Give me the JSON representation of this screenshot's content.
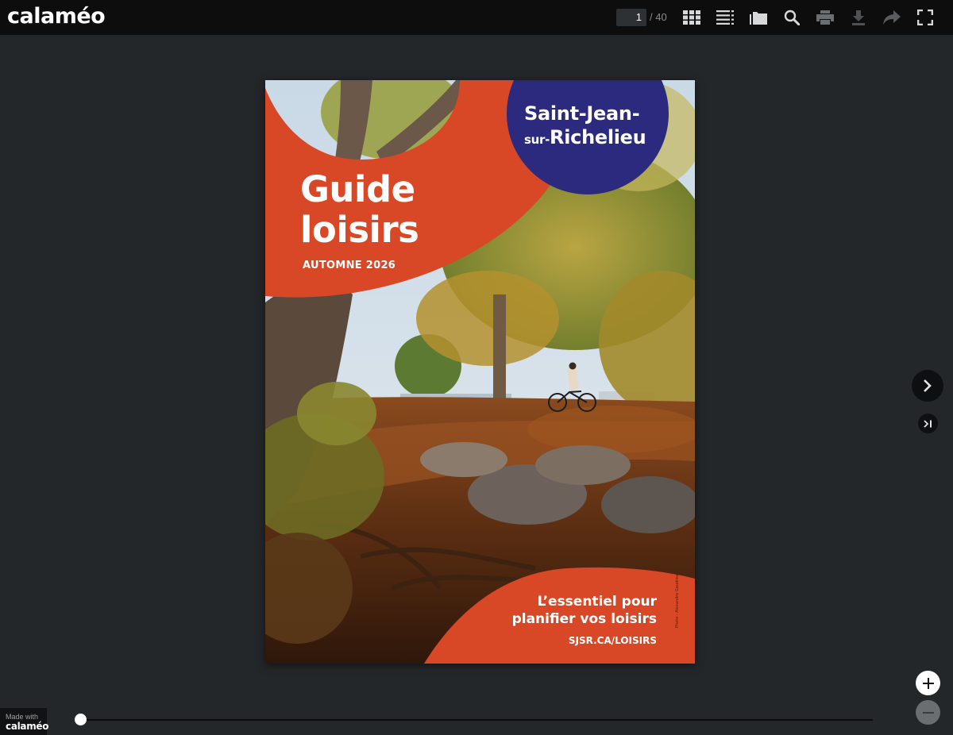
{
  "toolbar": {
    "logo": "calaméo",
    "current_page": "1",
    "total_pages": "/ 40",
    "icons": [
      "thumbnails-grid-icon",
      "table-of-contents-icon",
      "folder-icon",
      "search-icon",
      "print-icon",
      "download-icon",
      "share-icon",
      "fullscreen-icon"
    ]
  },
  "document": {
    "city_line1": "Saint-Jean-",
    "city_prefix": "sur-",
    "city_line2": "Richelieu",
    "title_line1": "Guide",
    "title_line2": "loisirs",
    "season": "AUTOMNE 2026",
    "tagline_line1": "L’essentiel pour",
    "tagline_line2": "planifier vos loisirs",
    "url": "SJSR.CA/LOISIRS",
    "photo_credit": "Photo : Alexandre Gaudreau",
    "colors": {
      "orange": "#d94826",
      "navy": "#2b2a7f"
    }
  },
  "navigation": {
    "icons": [
      "next-page-icon",
      "last-page-icon",
      "zoom-in-icon",
      "zoom-out-icon"
    ]
  },
  "footer": {
    "made_with": "Made with",
    "brand": "calaméo",
    "progress": 0
  }
}
